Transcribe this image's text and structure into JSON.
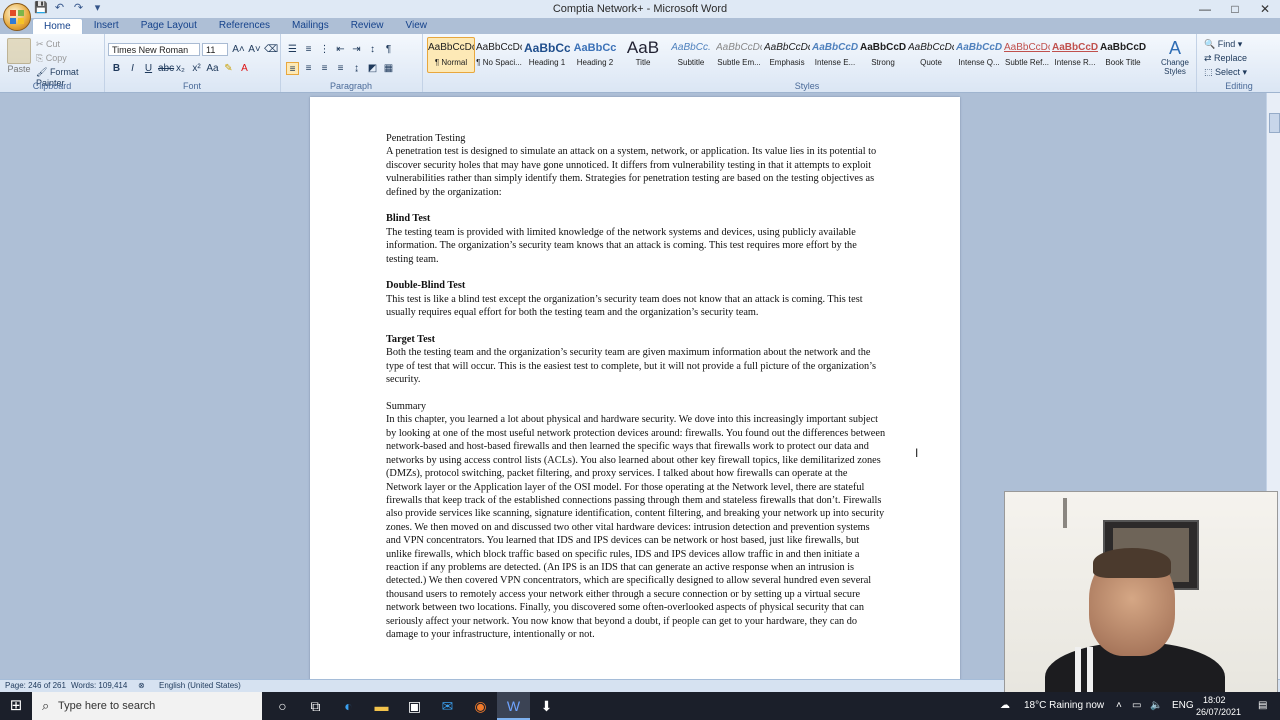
{
  "window": {
    "title": "Comptia Network+ - Microsoft Word"
  },
  "window_controls": [
    "—",
    "□",
    "✕"
  ],
  "qat": [
    "save",
    "undo",
    "redo",
    "customize"
  ],
  "tabs": [
    "Home",
    "Insert",
    "Page Layout",
    "References",
    "Mailings",
    "Review",
    "View"
  ],
  "active_tab": "Home",
  "ribbon": {
    "clipboard": {
      "paste": "Paste",
      "cut": "Cut",
      "copy": "Copy",
      "format_painter": "Format Painter",
      "label": "Clipboard"
    },
    "font": {
      "name": "Times New Roman",
      "size": "11",
      "label": "Font"
    },
    "paragraph": {
      "label": "Paragraph"
    },
    "styles": {
      "label": "Styles",
      "items": [
        {
          "preview": "AaBbCcDc",
          "name": "¶ Normal"
        },
        {
          "preview": "AaBbCcDc",
          "name": "¶ No Spaci..."
        },
        {
          "preview": "AaBbCc",
          "name": "Heading 1"
        },
        {
          "preview": "AaBbCc",
          "name": "Heading 2"
        },
        {
          "preview": "AaB",
          "name": "Title"
        },
        {
          "preview": "AaBbCc.",
          "name": "Subtitle"
        },
        {
          "preview": "AaBbCcDc",
          "name": "Subtle Em..."
        },
        {
          "preview": "AaBbCcDc",
          "name": "Emphasis"
        },
        {
          "preview": "AaBbCcDc",
          "name": "Intense E..."
        },
        {
          "preview": "AaBbCcDc",
          "name": "Strong"
        },
        {
          "preview": "AaBbCcDc",
          "name": "Quote"
        },
        {
          "preview": "AaBbCcDc",
          "name": "Intense Q..."
        },
        {
          "preview": "AaBbCcDc",
          "name": "Subtle Ref..."
        },
        {
          "preview": "AaBbCcDc",
          "name": "Intense R..."
        },
        {
          "preview": "AaBbCcDc",
          "name": "Book Title"
        }
      ],
      "change_styles": "Change Styles"
    },
    "editing": {
      "find": "Find",
      "replace": "Replace",
      "select": "Select",
      "label": "Editing"
    }
  },
  "document": {
    "h_pentest": "Penetration Testing",
    "p_pentest": "A penetration test is designed to simulate an attack on a system, network, or application. Its value lies in its potential to discover security holes that may have gone unnoticed. It differs from vulnerability testing in that it attempts to exploit vulnerabilities rather than simply identify them. Strategies for penetration testing are based on the testing objectives as defined by the organization:",
    "h_blind": "Blind Test",
    "p_blind": "The testing team is provided with limited knowledge of the network systems and devices, using publicly available information. The organization’s security team knows that an attack is coming. This test requires more effort by the testing team.",
    "h_double": "Double-Blind Test",
    "p_double": "This test is like a blind test except the organization’s security team does not know that an attack is coming. This test usually requires equal effort for both the testing team and the organization’s security team.",
    "h_target": "Target Test",
    "p_target": "Both the testing team and the organization’s security team are given maximum information about the network and the type of test that will occur. This is the easiest test to complete, but it will not provide a full picture of the organization’s security.",
    "h_summary": "Summary",
    "p_summary": "In this chapter, you learned a lot about physical and hardware security. We dove into this increasingly important subject by looking at one of the most useful network protection devices around: firewalls. You found out the differences between network-based and host-based firewalls and then learned the specific ways that firewalls work to protect our data and networks by using access control lists (ACLs). You also learned about other key firewall topics, like demilitarized zones (DMZs), protocol switching, packet filtering, and proxy services. I talked about how firewalls can operate at the Network layer or the Application layer of the OSI model. For those operating at the Network level, there are stateful firewalls that keep track of the established connections passing through them and stateless firewalls that don’t. Firewalls also provide services like scanning, signature identification, content filtering, and breaking your network up into security zones. We then moved on and discussed two other vital hardware devices: intrusion detection and prevention systems and VPN concentrators. You learned that IDS and IPS devices can be network or host based, just like firewalls, but unlike firewalls, which block traffic based on specific rules, IDS and IPS devices allow traffic in and then initiate a reaction if any problems are detected. (An IPS is an IDS that can generate an active response when an intrusion is detected.) We then covered VPN concentrators, which are specifically designed to allow several hundred even several thousand users to remotely access your network either through a secure connection or by setting up a virtual secure network between two locations. Finally, you discovered some often-overlooked aspects of physical security that can seriously affect your network. You now know that beyond a doubt, if people can get to your hardware, they can do damage to your infrastructure, intentionally or not."
  },
  "status": {
    "page": "Page: 246 of 261",
    "words": "Words: 109,414",
    "language": "English (United States)"
  },
  "taskbar": {
    "search_placeholder": "Type here to search",
    "weather": "18°C  Raining now",
    "lang": "ENG",
    "time": "18:02",
    "date": "26/07/2021"
  },
  "colors": {
    "ribbon": "#dbe6f4",
    "doc_bg": "#aebfd6",
    "taskbar": "#1b1f2a",
    "accent": "#15428b"
  }
}
